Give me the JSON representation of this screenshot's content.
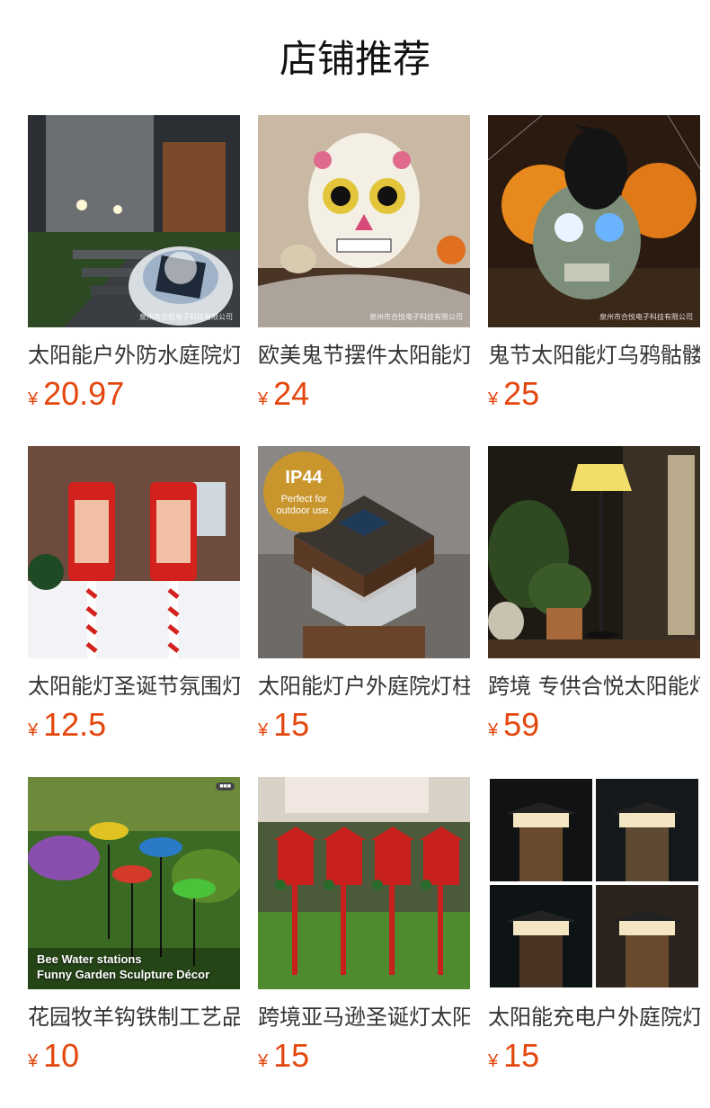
{
  "page": {
    "title": "店铺推荐"
  },
  "colors": {
    "price": "#e4470e",
    "title": "#111111"
  },
  "products": [
    {
      "name": "太阳能户外防水庭院灯",
      "currency": "¥",
      "price": "20.97",
      "watermark": "泉州市合悦电子科技有限公司",
      "image_icon": "solar-deck-light-image"
    },
    {
      "name": "欧美鬼节摆件太阳能灯",
      "currency": "¥",
      "price": "24",
      "watermark": "泉州市合悦电子科技有限公司",
      "image_icon": "sugar-skull-image"
    },
    {
      "name": "鬼节太阳能灯乌鸦骷髅",
      "currency": "¥",
      "price": "25",
      "watermark": "泉州市合悦电子科技有限公司",
      "image_icon": "crow-skull-image"
    },
    {
      "name": "太阳能灯圣诞节氛围灯",
      "currency": "¥",
      "price": "12.5",
      "image_icon": "candy-cane-lantern-image"
    },
    {
      "name": "太阳能灯户外庭院灯柱",
      "currency": "¥",
      "price": "15",
      "badge_title": "IP44",
      "badge_line1": "Perfect for",
      "badge_line2": "outdoor use.",
      "image_icon": "post-cap-light-image"
    },
    {
      "name": "跨境 专供合悦太阳能灯",
      "currency": "¥",
      "price": "59",
      "image_icon": "floor-lamp-image"
    },
    {
      "name": "花园牧羊钩铁制工艺品",
      "currency": "¥",
      "price": "10",
      "overlay_line1": "Bee Water stations",
      "overlay_line2": "Funny Garden Sculpture Décor",
      "image_icon": "bee-water-station-image"
    },
    {
      "name": "跨境亚马逊圣诞灯太阳能",
      "currency": "¥",
      "price": "15",
      "image_icon": "red-lantern-stakes-image"
    },
    {
      "name": "太阳能充电户外庭院灯",
      "currency": "¥",
      "price": "15",
      "image_icon": "post-cap-grid-image"
    }
  ]
}
